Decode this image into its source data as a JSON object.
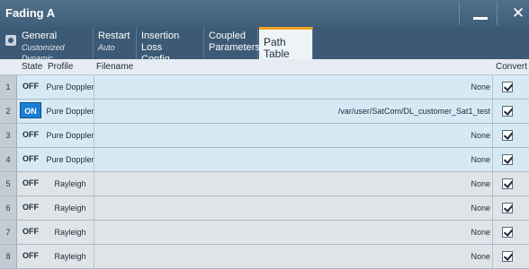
{
  "window": {
    "title": "Fading A",
    "minimize_icon": "minimize-icon",
    "close_glyph": "✕"
  },
  "tabs": [
    {
      "label": "General",
      "sub": "Customized Dynamic"
    },
    {
      "label": "Restart",
      "sub": "Auto"
    },
    {
      "label": "Insertion Loss",
      "label2": "Config"
    },
    {
      "label": "Coupled",
      "label2": "Parameters"
    },
    {
      "label": "Path Table"
    }
  ],
  "table": {
    "headers": {
      "state": "State",
      "profile": "Profile",
      "filename": "Filename",
      "convert": "Convert"
    },
    "rows": [
      {
        "num": "1",
        "state": "OFF",
        "profile": "Pure Doppler",
        "filename": "None",
        "convert": true
      },
      {
        "num": "2",
        "state": "ON",
        "profile": "Pure Doppler",
        "filename": "/var/user/SatCom/DL_customer_Sat1_test",
        "convert": true
      },
      {
        "num": "3",
        "state": "OFF",
        "profile": "Pure Doppler",
        "filename": "None",
        "convert": true
      },
      {
        "num": "4",
        "state": "OFF",
        "profile": "Pure Doppler",
        "filename": "None",
        "convert": true
      },
      {
        "num": "5",
        "state": "OFF",
        "profile": "Rayleigh",
        "filename": "None",
        "convert": true
      },
      {
        "num": "6",
        "state": "OFF",
        "profile": "Rayleigh",
        "filename": "None",
        "convert": true
      },
      {
        "num": "7",
        "state": "OFF",
        "profile": "Rayleigh",
        "filename": "None",
        "convert": true
      },
      {
        "num": "8",
        "state": "OFF",
        "profile": "Rayleigh",
        "filename": "None",
        "convert": true
      }
    ]
  }
}
